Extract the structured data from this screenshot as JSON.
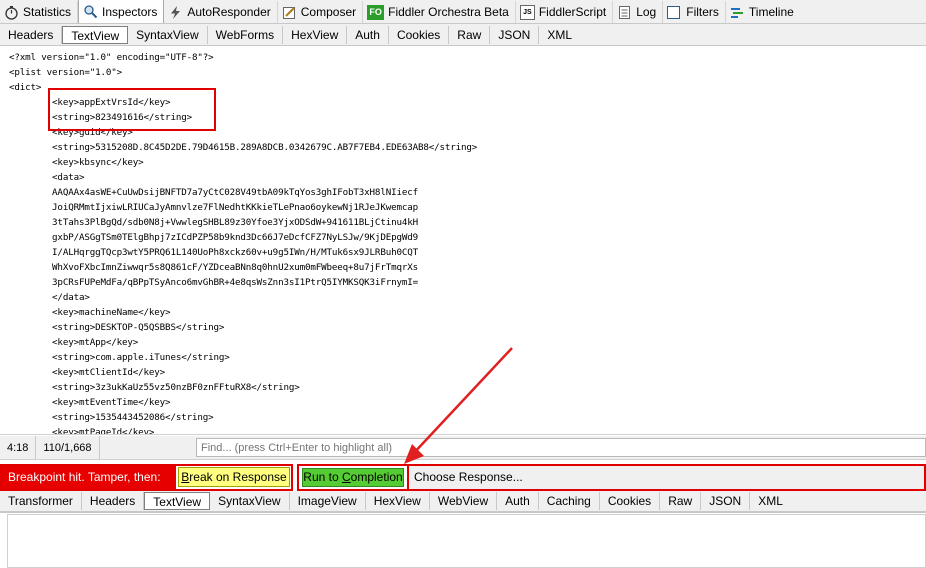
{
  "top_tabs": [
    {
      "label": "Statistics",
      "icon": "stopwatch-icon",
      "active": false
    },
    {
      "label": "Inspectors",
      "icon": "magnifier-icon",
      "active": true
    },
    {
      "label": "AutoResponder",
      "icon": "lightning-icon",
      "active": false
    },
    {
      "label": "Composer",
      "icon": "pencil-icon",
      "active": false
    },
    {
      "label": "Fiddler Orchestra Beta",
      "icon": "fo-icon",
      "active": false
    },
    {
      "label": "FiddlerScript",
      "icon": "js-icon",
      "active": false
    },
    {
      "label": "Log",
      "icon": "log-icon",
      "active": false
    },
    {
      "label": "Filters",
      "icon": "checkbox-icon",
      "active": false
    },
    {
      "label": "Timeline",
      "icon": "timeline-icon",
      "active": false
    }
  ],
  "request_tabs": [
    "Headers",
    "TextView",
    "SyntaxView",
    "WebForms",
    "HexView",
    "Auth",
    "Cookies",
    "Raw",
    "JSON",
    "XML"
  ],
  "request_active_tab": "TextView",
  "code_lines": [
    "<?xml version=\"1.0\" encoding=\"UTF-8\"?>",
    "<plist version=\"1.0\">",
    "<dict>",
    "        <key>appExtVrsId</key>",
    "        <string>823491616</string>",
    "        <key>guid</key>",
    "        <string>5315208D.8C45D2DE.79D4615B.289A8DCB.0342679C.AB7F7EB4.EDE63AB8</string>",
    "        <key>kbsync</key>",
    "        <data>",
    "        AAQAAx4asWE+CuUwDsijBNFTD7a7yCtC028V49tbA09kTqYos3ghIFobT3xH8lNIiecf",
    "        JoiQRMmtIjxiwLRIUCaJyAmnvlze7FlNedhtKKkieTLePnao6oykewNj1RJeJKwemcap",
    "        3tTahs3PlBgQd/sdb0N8j+VwwlegSHBL89z30Yfoe3YjxODSdW+941611BLjCtinu4kH",
    "        gxbP/ASGgTSm0TElgBhpj7zICdPZP58b9knd3Dc66J7eDcfCFZ7NyLSJw/9KjDEpgWd9",
    "        I/ALHqrggTQcp3wtY5PRQ61L140UoPh8xckz60v+u9g5IWn/H/MTuk6sx9JLRBuh0CQT",
    "        WhXvoFXbcImnZiwwqr5s8Q861cF/YZDceaBNn8q0hnU2xum0mFWbeeq+8u7jFrTmqrXs",
    "        3pCRsFUPeMdFa/qBPpTSyAnco6mvGhBR+4e8qsWsZnn3sI1PtrQ5IYMKSQK3iFrnymI=",
    "        </data>",
    "        <key>machineName</key>",
    "        <string>DESKTOP-Q5QSBBS</string>",
    "        <key>mtApp</key>",
    "        <string>com.apple.iTunes</string>",
    "        <key>mtClientId</key>",
    "        <string>3z3ukKaUz55vz50nzBF0znFFtuRX8</string>",
    "        <key>mtEventTime</key>",
    "        <string>1535443452086</string>",
    "        <key>mtPageId</key>"
  ],
  "status": {
    "position": "4:18",
    "count": "110/1,668"
  },
  "find_placeholder": "Find... (press Ctrl+Enter to highlight all)",
  "breakpoint": {
    "message": "Breakpoint hit. Tamper, then:",
    "break_on_response_prefix": "",
    "break_on_response_hotkey": "B",
    "break_on_response_rest": "reak on Response",
    "run_prefix": "Run to ",
    "run_hotkey": "C",
    "run_rest": "ompletion",
    "choose_response": "Choose Response..."
  },
  "response_tabs": [
    "Transformer",
    "Headers",
    "TextView",
    "SyntaxView",
    "ImageView",
    "HexView",
    "WebView",
    "Auth",
    "Caching",
    "Cookies",
    "Raw",
    "JSON",
    "XML"
  ],
  "response_active_tab": "TextView",
  "colors": {
    "annotation": "#e00000",
    "break_button": "#ffff80",
    "run_button": "#55cc33",
    "breakpoint_bar": "#e60000"
  }
}
